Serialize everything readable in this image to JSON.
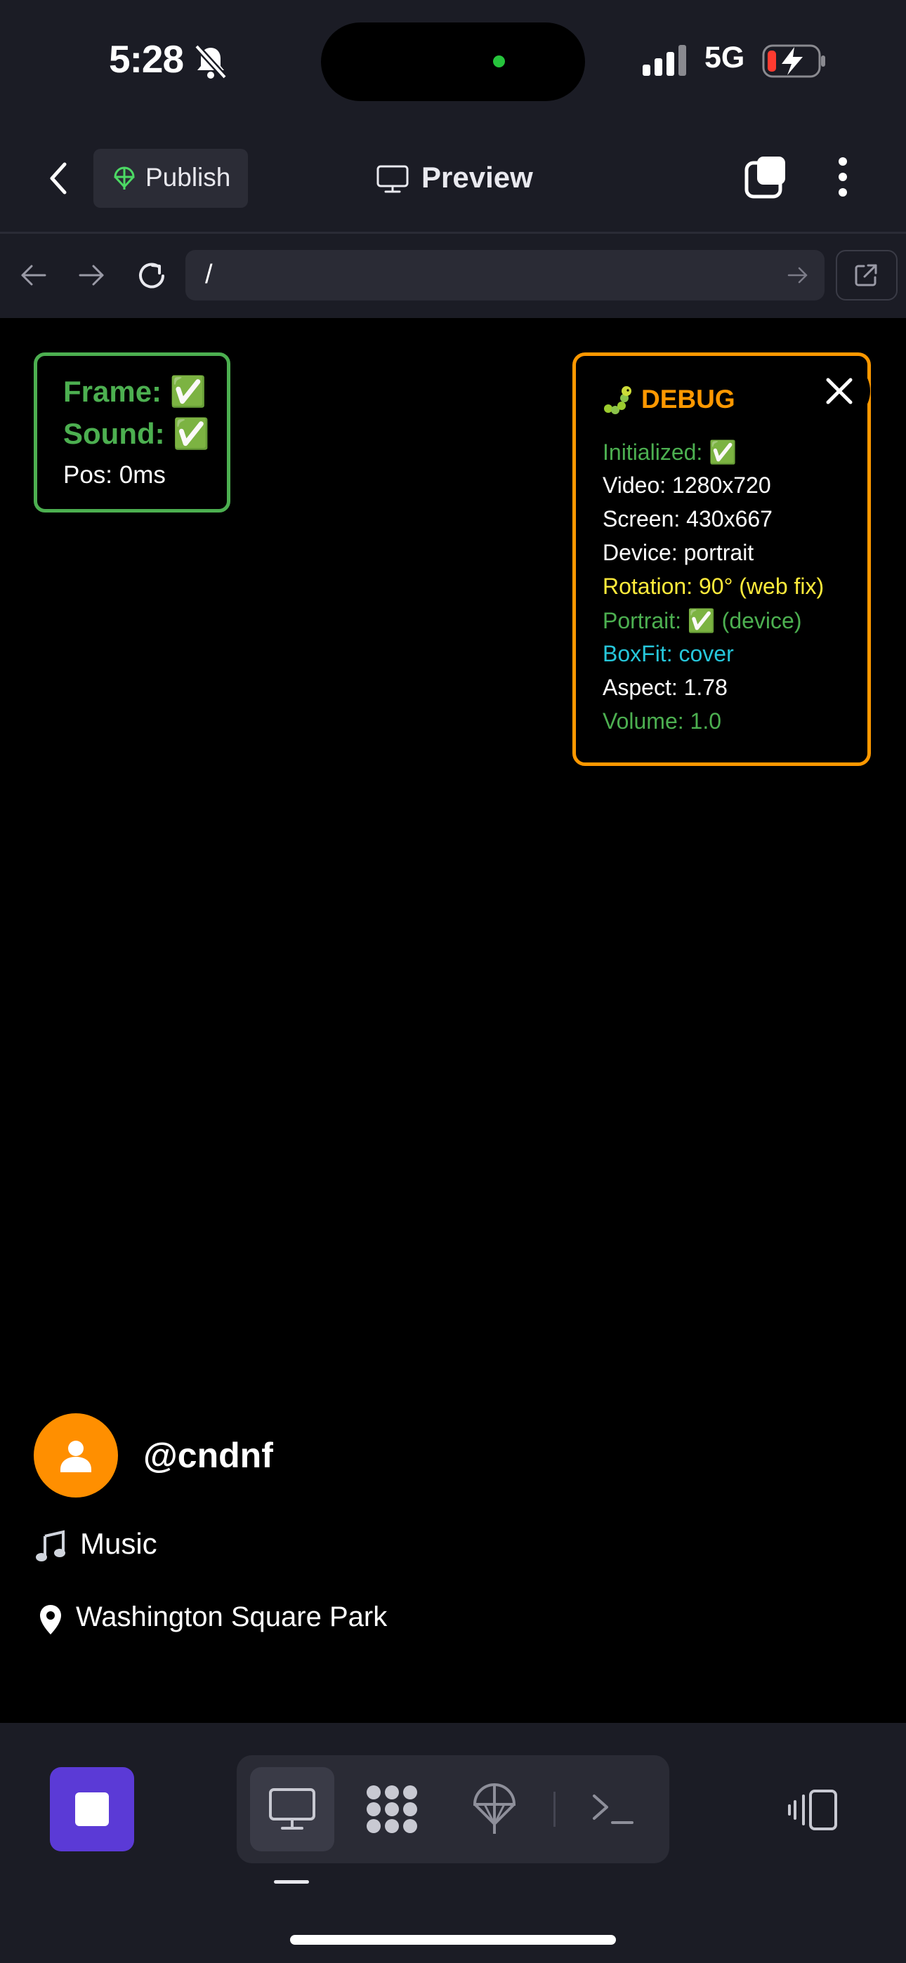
{
  "status_bar": {
    "time": "5:28",
    "network": "5G"
  },
  "header": {
    "publish_label": "Publish",
    "preview_label": "Preview"
  },
  "browser": {
    "url": "/"
  },
  "status_box": {
    "frame": "Frame: ✅",
    "sound": "Sound: ✅",
    "position": "Pos: 0ms"
  },
  "debug": {
    "title": "DEBUG",
    "lines": [
      {
        "text": "Initialized: ✅",
        "color": "#4caf50"
      },
      {
        "text": "Video: 1280x720",
        "color": "#ffffff"
      },
      {
        "text": "Screen: 430x667",
        "color": "#ffffff"
      },
      {
        "text": "Device: portrait",
        "color": "#ffffff"
      },
      {
        "text": "Rotation: 90° (web fix)",
        "color": "#ffeb3b"
      },
      {
        "text": "Portrait: ✅ (device)",
        "color": "#4caf50"
      },
      {
        "text": "BoxFit: cover",
        "color": "#26c6da"
      },
      {
        "text": "Aspect: 1.78",
        "color": "#ffffff"
      },
      {
        "text": "Volume: 1.0",
        "color": "#4caf50"
      }
    ]
  },
  "video": {
    "username": "@cndnf",
    "music": "Music",
    "location": "Washington Square Park"
  },
  "icons": [
    "bell-slash-icon",
    "signal-icon",
    "battery-charging-icon",
    "back-chevron-icon",
    "publish-icon",
    "monitor-icon",
    "tabs-icon",
    "more-vert-icon",
    "arrow-left-icon",
    "arrow-right-icon",
    "reload-icon",
    "go-icon",
    "external-link-icon",
    "close-icon",
    "bug-icon",
    "person-icon",
    "music-note-icon",
    "location-pin-icon",
    "stop-icon",
    "preview-tool-icon",
    "assets-tool-icon",
    "deploy-tool-icon",
    "terminal-icon",
    "device-toggle-icon"
  ],
  "colors": {
    "accent_purple": "#5b3ad6",
    "debug_orange": "#ff9800",
    "status_green": "#4caf50",
    "avatar_orange": "#ff8f00",
    "chrome_bg": "#1b1c25"
  }
}
